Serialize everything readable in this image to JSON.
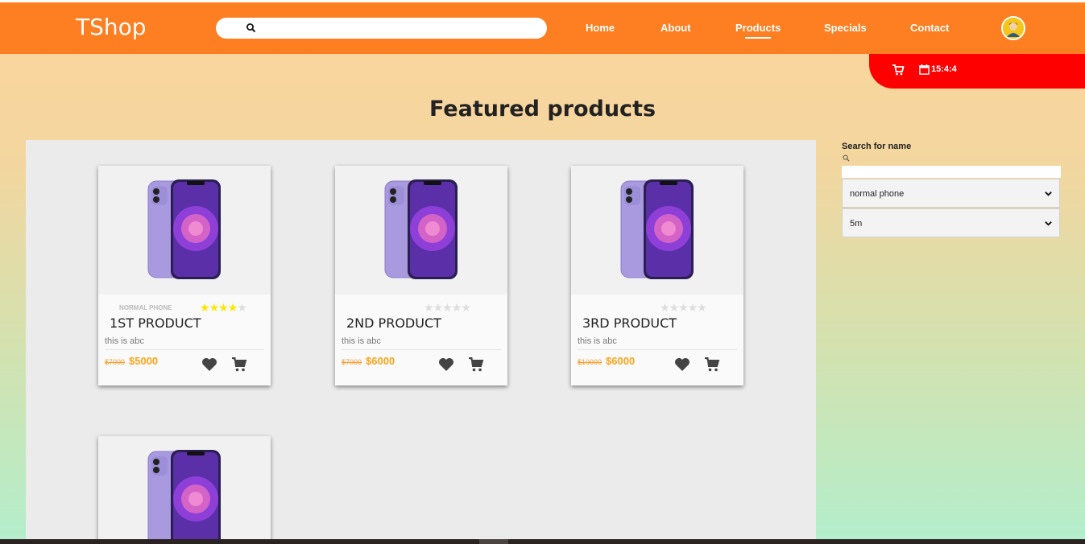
{
  "header": {
    "logo": "TShop",
    "search_placeholder": "",
    "nav": [
      {
        "label": "Home",
        "active": false
      },
      {
        "label": "About",
        "active": false
      },
      {
        "label": "Products",
        "active": true
      },
      {
        "label": "Specials",
        "active": false
      },
      {
        "label": "Contact",
        "active": false
      }
    ],
    "accent": "#fd7f21"
  },
  "status_bar": {
    "time": "15:4:4",
    "color": "#ff0000"
  },
  "page_title": "Featured products",
  "products": [
    {
      "category": "normal phone",
      "rating": 4,
      "name": "1ST PRODUCT",
      "description": "this is abc",
      "old_price": "$7000",
      "price": "$5000"
    },
    {
      "category": "",
      "rating": 0,
      "name": "2ND PRODUCT",
      "description": "this is abc",
      "old_price": "$7000",
      "price": "$6000"
    },
    {
      "category": "",
      "rating": 0,
      "name": "3RD PRODUCT",
      "description": "this is abc",
      "old_price": "$10000",
      "price": "$6000"
    }
  ],
  "filters": {
    "search_label": "Search for name",
    "search_value": "",
    "category_select": "normal phone",
    "time_select": "5m"
  }
}
